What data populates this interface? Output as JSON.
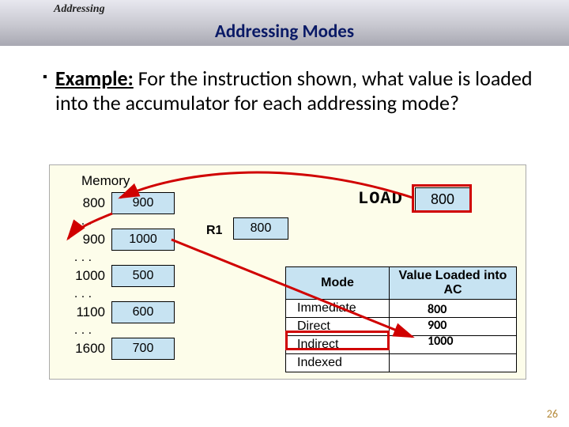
{
  "chapter": "Addressing",
  "title": "Addressing Modes",
  "example_label": "Example:",
  "example_text": " For the instruction shown, what value is loaded into the accumulator for each addressing mode?",
  "memory": {
    "label": "Memory",
    "rows": [
      {
        "addr": "800",
        "val": "900"
      },
      {
        "addr": "900",
        "val": "1000"
      },
      {
        "addr": "1000",
        "val": "500"
      },
      {
        "addr": "1100",
        "val": "600"
      },
      {
        "addr": "1600",
        "val": "700"
      }
    ],
    "dots": ". . ."
  },
  "register": {
    "name": "R1",
    "value": "800"
  },
  "instruction": {
    "op": "LOAD",
    "operand": "800"
  },
  "modes_table": {
    "hdr_mode": "Mode",
    "hdr_val": "Value Loaded into AC",
    "modes": [
      "Immediate",
      "Direct",
      "Indirect",
      "Indexed"
    ]
  },
  "answers": {
    "immediate": "800",
    "direct": "900",
    "indirect": "1000"
  },
  "slide_number": "26"
}
